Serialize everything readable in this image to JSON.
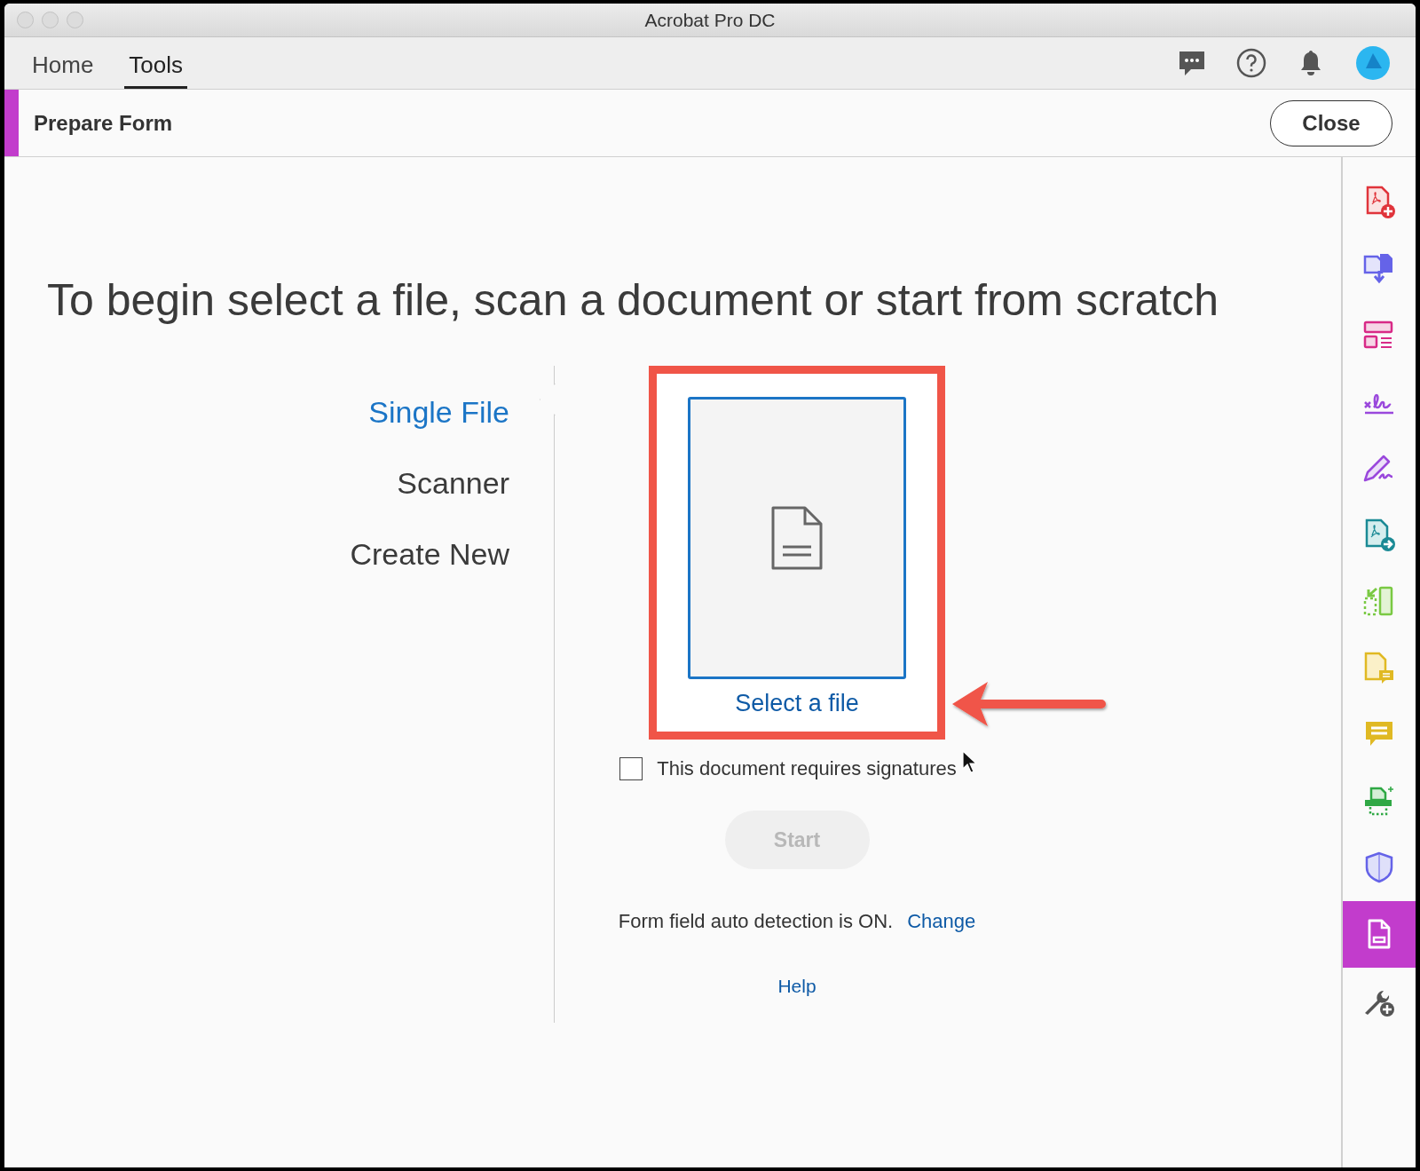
{
  "window": {
    "title": "Acrobat Pro DC"
  },
  "nav_tabs": [
    {
      "label": "Home",
      "selected": false
    },
    {
      "label": "Tools",
      "selected": true
    }
  ],
  "tool_bar": {
    "title": "Prepare Form",
    "close_button": "Close"
  },
  "heading": "To begin select a file, scan a document or start from scratch",
  "sources": [
    {
      "label": "Single File",
      "selected": true
    },
    {
      "label": "Scanner",
      "selected": false
    },
    {
      "label": "Create New",
      "selected": false
    }
  ],
  "file_picker": {
    "label": "Select a file"
  },
  "signatures_checkbox": {
    "label": "This document requires signatures",
    "checked": false
  },
  "start_button": {
    "label": "Start",
    "disabled": true
  },
  "auto_detection": {
    "text": "Form field auto detection is ON.",
    "link": "Change"
  },
  "help_link": "Help",
  "tool_rail": [
    {
      "kind": "create-pdf",
      "selected": false
    },
    {
      "kind": "combine",
      "selected": false
    },
    {
      "kind": "organize",
      "selected": false
    },
    {
      "kind": "fill-sign",
      "selected": false
    },
    {
      "kind": "sign",
      "selected": false
    },
    {
      "kind": "export",
      "selected": false
    },
    {
      "kind": "compare",
      "selected": false
    },
    {
      "kind": "send-comments",
      "selected": false
    },
    {
      "kind": "comment",
      "selected": false
    },
    {
      "kind": "print",
      "selected": false
    },
    {
      "kind": "protect",
      "selected": false
    },
    {
      "kind": "prepare-form",
      "selected": true
    },
    {
      "kind": "more-tools",
      "selected": false
    }
  ]
}
